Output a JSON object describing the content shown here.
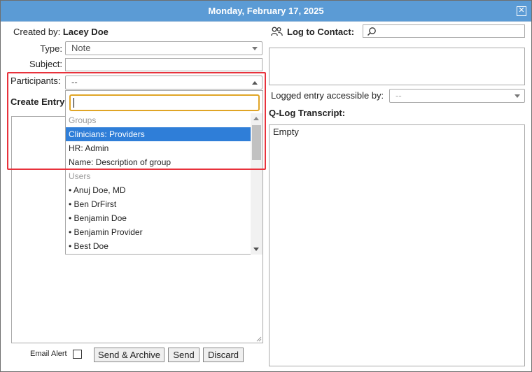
{
  "window": {
    "title": "Monday, February 17, 2025"
  },
  "created_by": {
    "label": "Created by:",
    "value": "Lacey Doe"
  },
  "type": {
    "label": "Type:",
    "value": "Note"
  },
  "subject": {
    "label": "Subject:",
    "value": ""
  },
  "participants": {
    "label": "Participants:",
    "value": "--",
    "search_value": "",
    "list": [
      {
        "text": "Groups",
        "kind": "header"
      },
      {
        "text": "Clinicians: Providers",
        "kind": "selected"
      },
      {
        "text": "HR: Admin",
        "kind": "option"
      },
      {
        "text": "Name: Description of group",
        "kind": "option"
      },
      {
        "text": "Users",
        "kind": "header"
      },
      {
        "text": "• Anuj Doe, MD",
        "kind": "option"
      },
      {
        "text": "• Ben DrFirst",
        "kind": "option"
      },
      {
        "text": "• Benjamin Doe",
        "kind": "option"
      },
      {
        "text": "• Benjamin Provider",
        "kind": "option"
      },
      {
        "text": "• Best Doe",
        "kind": "option"
      }
    ]
  },
  "create_entry": {
    "label": "Create Entry"
  },
  "email_alert": {
    "label": "Email Alert"
  },
  "buttons": {
    "send_archive": "Send & Archive",
    "send": "Send",
    "discard": "Discard"
  },
  "log_to_contact": {
    "label": "Log to Contact:",
    "value": ""
  },
  "logged_entry": {
    "label": "Logged entry accessible by:",
    "value": "--"
  },
  "transcript": {
    "label": "Q-Log Transcript:",
    "value": "Empty"
  },
  "colors": {
    "titlebar": "#5b9bd5",
    "selected": "#2f7ed8",
    "highlight": "#e8323c",
    "focus": "#e0a526"
  },
  "icons": {
    "close": "close-icon",
    "contacts": "people-icon",
    "search": "search-icon"
  }
}
